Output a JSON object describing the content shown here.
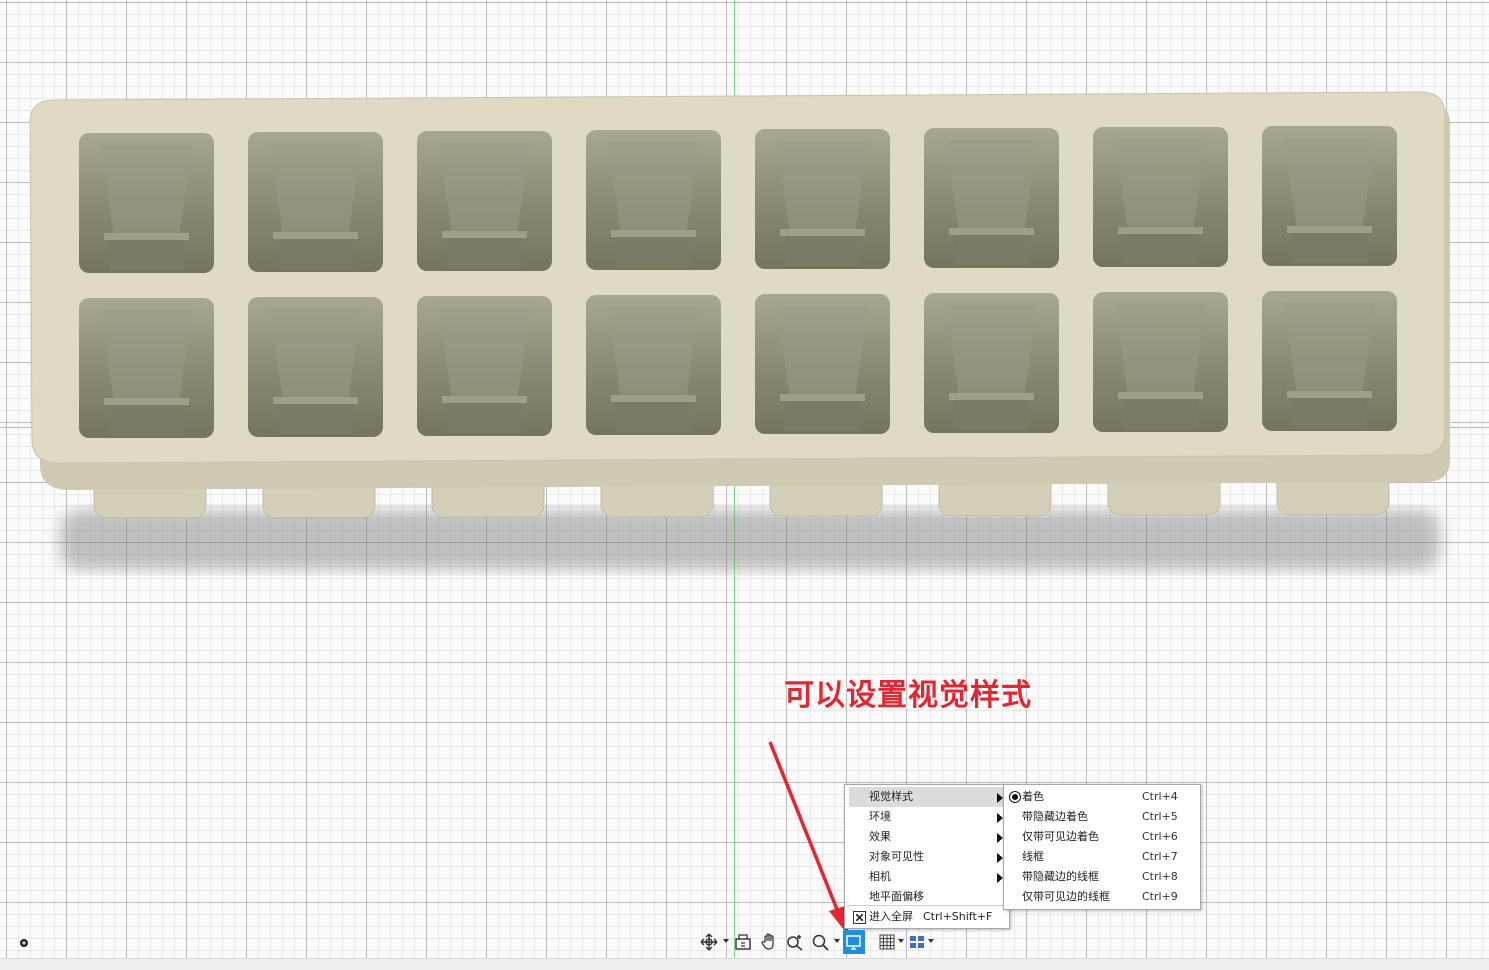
{
  "annotation": {
    "text": "可以设置视觉样式",
    "color": "#e8242e"
  },
  "context_menu": {
    "items": [
      {
        "label": "视觉样式",
        "has_submenu": true,
        "highlighted": true
      },
      {
        "label": "环境",
        "has_submenu": true
      },
      {
        "label": "效果",
        "has_submenu": true
      },
      {
        "label": "对象可见性",
        "has_submenu": true
      },
      {
        "label": "相机",
        "has_submenu": true
      },
      {
        "label": "地平面偏移",
        "has_submenu": false
      }
    ],
    "fullscreen": {
      "label": "进入全屏",
      "shortcut": "Ctrl+Shift+F",
      "icon": "fullscreen-icon"
    }
  },
  "visual_style_submenu": {
    "items": [
      {
        "label": "着色",
        "shortcut": "Ctrl+4",
        "selected": true
      },
      {
        "label": "带隐藏边着色",
        "shortcut": "Ctrl+5"
      },
      {
        "label": "仅带可见边着色",
        "shortcut": "Ctrl+6"
      },
      {
        "label": "线框",
        "shortcut": "Ctrl+7"
      },
      {
        "label": "带隐藏边的线框",
        "shortcut": "Ctrl+8"
      },
      {
        "label": "仅带可见边的线框",
        "shortcut": "Ctrl+9"
      }
    ]
  },
  "toolbar": {
    "buttons": [
      {
        "icon": "orbit-icon",
        "dropdown": true
      },
      {
        "icon": "look-at-icon",
        "dropdown": false
      },
      {
        "icon": "pan-hand-icon",
        "dropdown": false
      },
      {
        "icon": "zoom-icon",
        "dropdown": false
      },
      {
        "icon": "zoom-window-icon",
        "dropdown": true
      },
      {
        "icon": "display-settings-icon",
        "dropdown": true,
        "active": true
      },
      {
        "icon": "grid-snaps-icon",
        "dropdown": true
      },
      {
        "icon": "viewports-icon",
        "dropdown": true
      }
    ],
    "active_color": "#1e8fe0"
  },
  "model": {
    "name": "ice-cube-tray",
    "color": "#dedac3",
    "cavity_rows": 2,
    "cavity_columns": 8
  },
  "axes": {
    "green": "#7fd87f",
    "red": "#f0a0a0"
  }
}
